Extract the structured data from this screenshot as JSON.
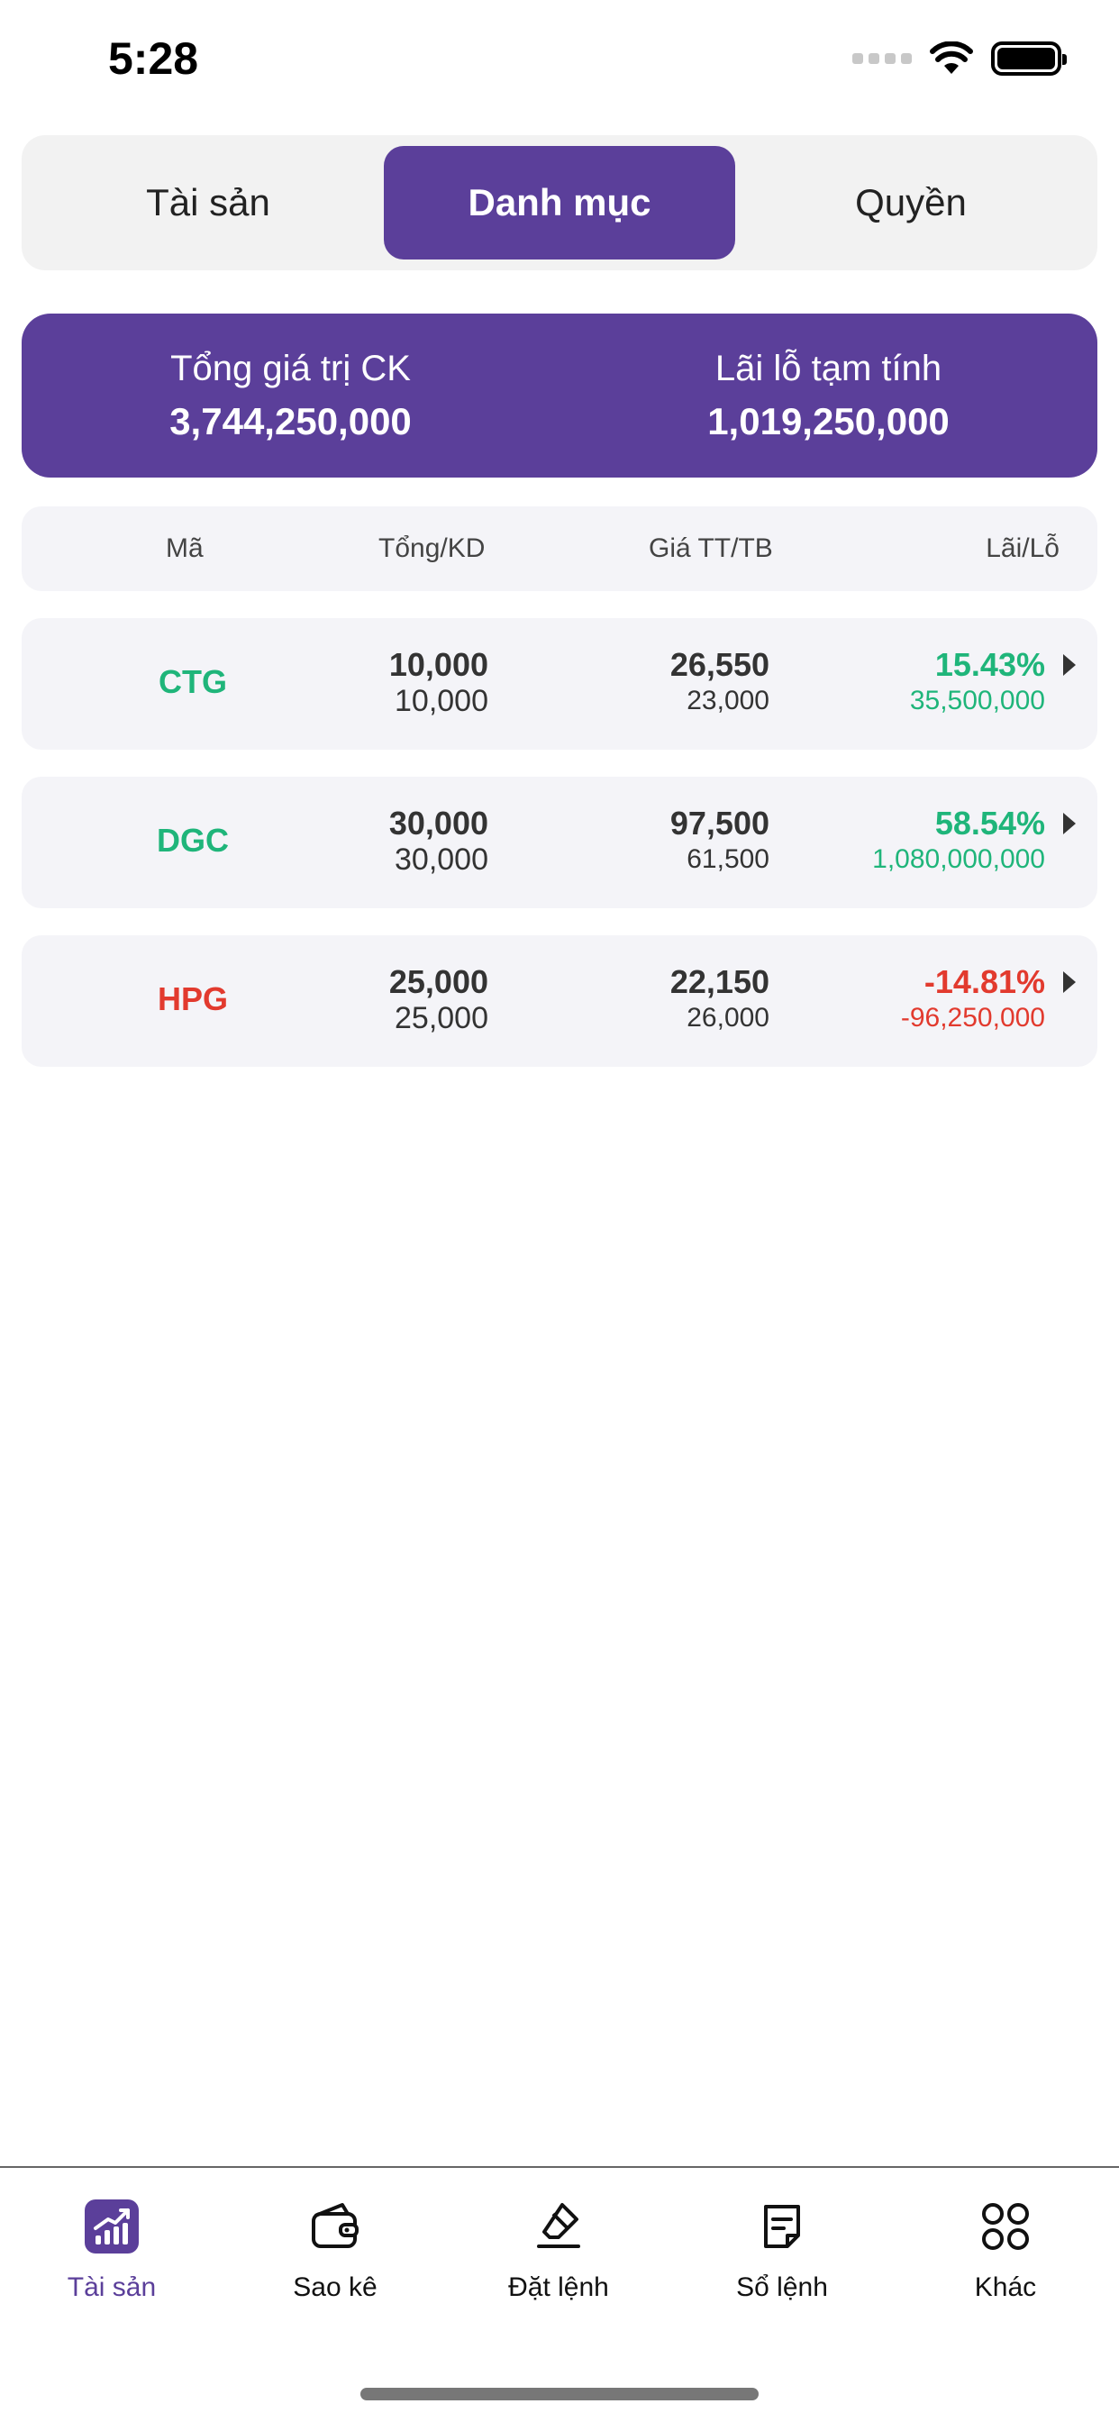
{
  "status_bar": {
    "time": "5:28"
  },
  "tabs": [
    {
      "label": "Tài sản",
      "active": false
    },
    {
      "label": "Danh mục",
      "active": true
    },
    {
      "label": "Quyền",
      "active": false
    }
  ],
  "summary": {
    "total_label": "Tổng giá trị CK",
    "total_value": "3,744,250,000",
    "pl_label": "Lãi lỗ tạm tính",
    "pl_value": "1,019,250,000"
  },
  "table": {
    "headers": {
      "code": "Mã",
      "total": "Tổng/KD",
      "price": "Giá TT/TB",
      "pl": "Lãi/Lỗ"
    },
    "rows": [
      {
        "code": "CTG",
        "total": "10,000",
        "available": "10,000",
        "market_price": "26,550",
        "avg_price": "23,000",
        "pl_percent": "15.43%",
        "pl_amount": "35,500,000",
        "color": "#1fb57a"
      },
      {
        "code": "DGC",
        "total": "30,000",
        "available": "30,000",
        "market_price": "97,500",
        "avg_price": "61,500",
        "pl_percent": "58.54%",
        "pl_amount": "1,080,000,000",
        "color": "#1fb57a"
      },
      {
        "code": "HPG",
        "total": "25,000",
        "available": "25,000",
        "market_price": "22,150",
        "avg_price": "26,000",
        "pl_percent": "-14.81%",
        "pl_amount": "-96,250,000",
        "color": "#e23a2e"
      }
    ]
  },
  "nav": [
    {
      "label": "Tài sản",
      "icon": "chart-icon",
      "active": true
    },
    {
      "label": "Sao kê",
      "icon": "wallet-icon",
      "active": false
    },
    {
      "label": "Đặt lệnh",
      "icon": "eraser-icon",
      "active": false
    },
    {
      "label": "Sổ lệnh",
      "icon": "document-icon",
      "active": false
    },
    {
      "label": "Khác",
      "icon": "grid-icon",
      "active": false
    }
  ],
  "colors": {
    "accent": "#5b3f9a",
    "up": "#1fb57a",
    "down": "#e23a2e"
  }
}
